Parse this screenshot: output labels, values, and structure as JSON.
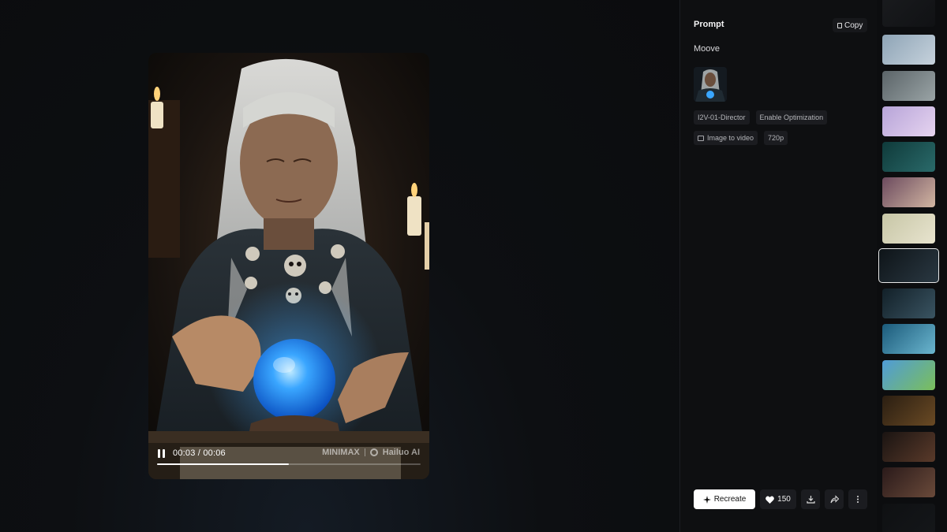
{
  "player": {
    "current_time": "00:03",
    "separator": " / ",
    "duration": "00:06",
    "progress": 0.5,
    "watermark_left": "MINIMAX",
    "watermark_right": "Hailuo AI"
  },
  "details": {
    "prompt_heading": "Prompt",
    "copy_label": "Copy",
    "prompt_text": "Moove",
    "tags": [
      {
        "label": "I2V-01-Director",
        "icon": ""
      },
      {
        "label": "Enable Optimization",
        "icon": ""
      },
      {
        "label": "Image to video",
        "icon": "image-icon"
      },
      {
        "label": "720p",
        "icon": ""
      }
    ]
  },
  "actions": {
    "recreate_label": "Recreate",
    "likes": "150",
    "icons": [
      "sparkle-icon",
      "heart-icon",
      "download-icon",
      "share-icon",
      "more-icon"
    ]
  },
  "thumbnails": [
    {
      "name": "thumb-figures",
      "colors": [
        "#2a2c30",
        "#15171a"
      ]
    },
    {
      "name": "thumb-snow-creature",
      "colors": [
        "#8ea4b6",
        "#c6d2dc"
      ]
    },
    {
      "name": "thumb-fog-figure",
      "colors": [
        "#5b6468",
        "#9aa4a6"
      ]
    },
    {
      "name": "thumb-woman-pink",
      "colors": [
        "#b7a4d8",
        "#e6d4f0"
      ]
    },
    {
      "name": "thumb-green-figure",
      "colors": [
        "#0f3a3a",
        "#2a6a6a"
      ]
    },
    {
      "name": "thumb-room-portrait",
      "colors": [
        "#6b4a5e",
        "#d2b6a2"
      ]
    },
    {
      "name": "thumb-bird-flight",
      "colors": [
        "#c7c6a6",
        "#e8e4cf"
      ]
    },
    {
      "name": "thumb-witch-active",
      "colors": [
        "#0e1418",
        "#2a3842"
      ]
    },
    {
      "name": "thumb-stage-figure",
      "colors": [
        "#122028",
        "#3a5462"
      ]
    },
    {
      "name": "thumb-ocean-wave",
      "colors": [
        "#1b5a7a",
        "#6bb6cf"
      ]
    },
    {
      "name": "thumb-flying-dog",
      "colors": [
        "#4f9bd8",
        "#7bbf5a"
      ]
    },
    {
      "name": "thumb-dark-room",
      "colors": [
        "#2a1e12",
        "#6a4a24"
      ]
    },
    {
      "name": "thumb-man-suit",
      "colors": [
        "#1a1412",
        "#5a3a2a"
      ]
    },
    {
      "name": "thumb-hall-figure",
      "colors": [
        "#2a1a1a",
        "#6a4a3a"
      ]
    },
    {
      "name": "thumb-dark-end",
      "colors": [
        "#121416",
        "#1e2226"
      ]
    }
  ],
  "active_thumbnail": 7
}
